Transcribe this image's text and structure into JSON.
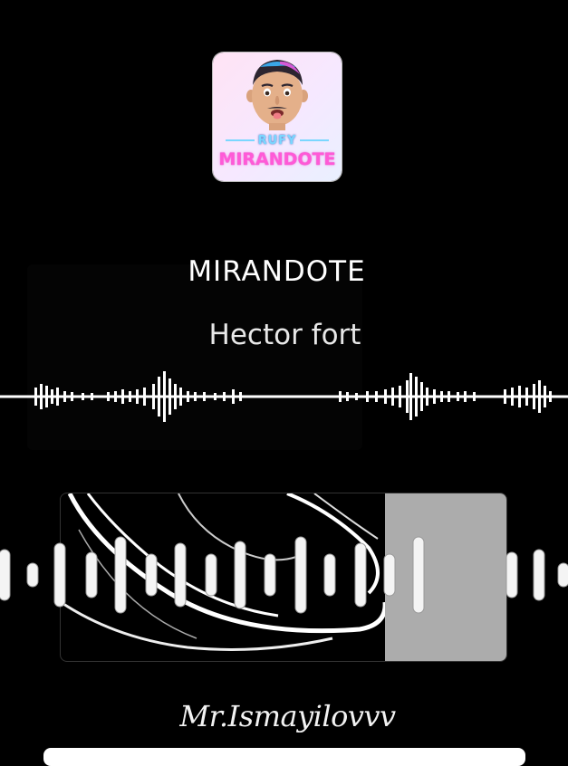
{
  "album_art": {
    "line1": "RUFY",
    "line2": "MIRANDOTE"
  },
  "track": {
    "title": "MIRANDOTE",
    "artist": "Hector fort"
  },
  "signature": "Mr.Ismayilovvv",
  "colors": {
    "background": "#000000",
    "accent_pink": "#ff5ad7",
    "accent_blue": "#7ad7ff",
    "bars": "#ffffff"
  }
}
